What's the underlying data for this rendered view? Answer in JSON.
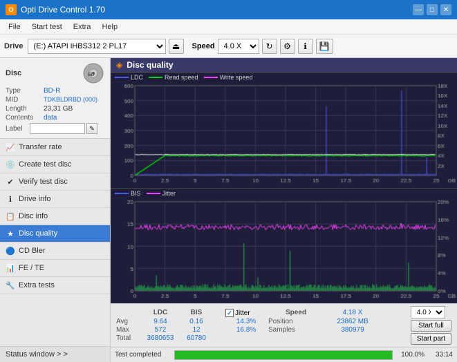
{
  "titlebar": {
    "title": "Opti Drive Control 1.70",
    "icon_label": "O",
    "minimize": "—",
    "maximize": "□",
    "close": "✕"
  },
  "menu": {
    "items": [
      "File",
      "Start test",
      "Extra",
      "Help"
    ]
  },
  "toolbar": {
    "drive_label": "Drive",
    "drive_value": "(E:)  ATAPI iHBS312  2 PL17",
    "speed_label": "Speed",
    "speed_value": "4.0 X"
  },
  "disc": {
    "section_title": "Disc",
    "type_label": "Type",
    "type_value": "BD-R",
    "mid_label": "MID",
    "mid_value": "TDKBLDRBD (000)",
    "length_label": "Length",
    "length_value": "23,31 GB",
    "contents_label": "Contents",
    "contents_value": "data",
    "label_label": "Label",
    "label_placeholder": ""
  },
  "nav": {
    "items": [
      {
        "id": "transfer-rate",
        "label": "Transfer rate",
        "icon": "📈"
      },
      {
        "id": "create-test-disc",
        "label": "Create test disc",
        "icon": "💿"
      },
      {
        "id": "verify-test-disc",
        "label": "Verify test disc",
        "icon": "✔"
      },
      {
        "id": "drive-info",
        "label": "Drive info",
        "icon": "ℹ"
      },
      {
        "id": "disc-info",
        "label": "Disc info",
        "icon": "📋"
      },
      {
        "id": "disc-quality",
        "label": "Disc quality",
        "icon": "★",
        "active": true
      },
      {
        "id": "cd-bler",
        "label": "CD Bler",
        "icon": "🔵"
      },
      {
        "id": "fe-te",
        "label": "FE / TE",
        "icon": "📊"
      },
      {
        "id": "extra-tests",
        "label": "Extra tests",
        "icon": "🔧"
      }
    ],
    "status_window": "Status window > >"
  },
  "chart": {
    "title": "Disc quality",
    "legend1": {
      "ldc_label": "LDC",
      "read_label": "Read speed",
      "write_label": "Write speed"
    },
    "legend2": {
      "bis_label": "BIS",
      "jitter_label": "Jitter"
    }
  },
  "stats": {
    "columns": [
      "LDC",
      "BIS"
    ],
    "jitter_label": "Jitter",
    "speed_label": "Speed",
    "speed_value": "4.18 X",
    "speed_select": "4.0 X",
    "position_label": "Position",
    "position_value": "23862 MB",
    "samples_label": "Samples",
    "samples_value": "380979",
    "rows": [
      {
        "label": "Avg",
        "ldc": "9.64",
        "bis": "0.16",
        "jitter": "14.3%"
      },
      {
        "label": "Max",
        "ldc": "572",
        "bis": "12",
        "jitter": "16.8%"
      },
      {
        "label": "Total",
        "ldc": "3680653",
        "bis": "60780",
        "jitter": ""
      }
    ],
    "start_full": "Start full",
    "start_part": "Start part"
  },
  "progress": {
    "status": "Test completed",
    "percent": "100.0%",
    "fill_percent": 100,
    "time": "33:14"
  }
}
